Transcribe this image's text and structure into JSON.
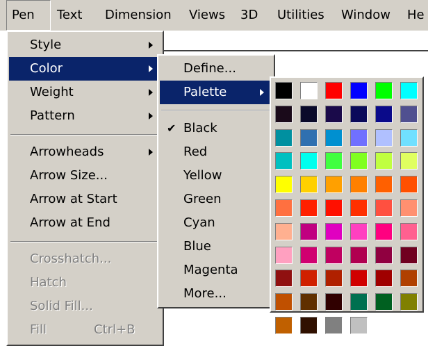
{
  "menubar": {
    "items": [
      "Pen",
      "Text",
      "Dimension",
      "Views",
      "3D",
      "Utilities",
      "Window",
      "He"
    ]
  },
  "pen_menu": {
    "items": [
      "Style",
      "Color",
      "Weight",
      "Pattern",
      "Arrowheads",
      "Arrow Size...",
      "Arrow at Start",
      "Arrow at End",
      "Crosshatch...",
      "Hatch",
      "Solid Fill...",
      "Fill"
    ],
    "fill_shortcut": "Ctrl+B"
  },
  "color_menu": {
    "items": [
      "Define...",
      "Palette",
      "Black",
      "Red",
      "Yellow",
      "Green",
      "Cyan",
      "Blue",
      "Magenta",
      "More..."
    ],
    "checked": "Black"
  },
  "palette": {
    "rows": [
      [
        "#000000",
        "#ffffff",
        "#ff0000",
        "#0000ff",
        "#00ff00",
        "#00ffff"
      ],
      [
        "#1a0a1a",
        "#0a0a2a",
        "#1a0a4a",
        "#0a0a5a",
        "#0a0a8a",
        "#505090"
      ],
      [
        "#0090a0",
        "#3070b0",
        "#0090d0",
        "#7070ff",
        "#b0c0ff",
        "#70e0ff"
      ],
      [
        "#00c0c0",
        "#00ffee",
        "#40ff40",
        "#80ff20",
        "#c0ff40",
        "#e0ff60"
      ],
      [
        "#ffff00",
        "#ffd000",
        "#ffa000",
        "#ff8000",
        "#ff6000",
        "#ff5000"
      ],
      [
        "#ff7040",
        "#ff2000",
        "#ff1000",
        "#ff3000",
        "#ff5040",
        "#ff9070"
      ],
      [
        "#ffb090",
        "#c00080",
        "#e000c0",
        "#ff40c0",
        "#ff0080",
        "#ff6090"
      ],
      [
        "#ffa0c0",
        "#d00070",
        "#c00060",
        "#b00050",
        "#900040",
        "#700020"
      ],
      [
        "#901010",
        "#d02000",
        "#b02000",
        "#d00000",
        "#a00000",
        "#b04000"
      ],
      [
        "#c05000",
        "#603000",
        "#300000",
        "#007050",
        "#006020",
        "#808000"
      ],
      [
        "#c06000",
        "#301000",
        "#808080",
        "#c0c0c0"
      ]
    ]
  }
}
